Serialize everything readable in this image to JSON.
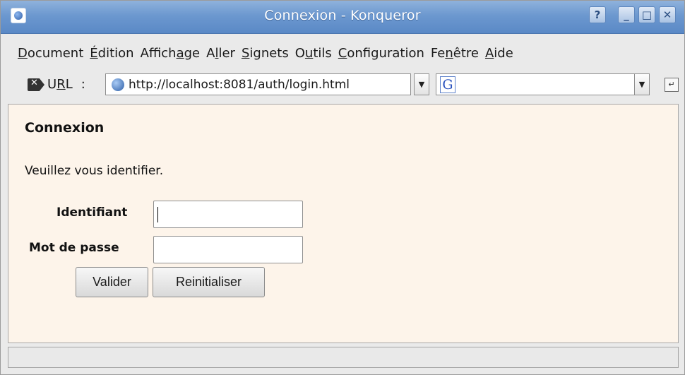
{
  "window": {
    "title": "Connexion - Konqueror",
    "buttons": {
      "help": "?",
      "minimize": "_",
      "maximize": "□",
      "close": "✕"
    }
  },
  "menu": {
    "items": [
      {
        "pre": "",
        "key": "D",
        "post": "ocument"
      },
      {
        "pre": "",
        "key": "É",
        "post": "dition"
      },
      {
        "pre": "Affich",
        "key": "a",
        "post": "ge"
      },
      {
        "pre": "A",
        "key": "l",
        "post": "ler"
      },
      {
        "pre": "",
        "key": "S",
        "post": "ignets"
      },
      {
        "pre": "O",
        "key": "u",
        "post": "tils"
      },
      {
        "pre": "",
        "key": "C",
        "post": "onfiguration"
      },
      {
        "pre": "Fe",
        "key": "n",
        "post": "être"
      },
      {
        "pre": "",
        "key": "A",
        "post": "ide"
      }
    ]
  },
  "toolbar": {
    "url_label_pre": "U",
    "url_label_key": "R",
    "url_label_post": "L",
    "url_label_colon": ":",
    "url_value": "http://localhost:8081/auth/login.html",
    "search_engine_glyph": "G",
    "search_value": ""
  },
  "page": {
    "heading": "Connexion",
    "intro": "Veuillez vous identifier.",
    "fields": {
      "username_label": "Identifiant",
      "username_value": "",
      "password_label": "Mot de passe",
      "password_value": ""
    },
    "buttons": {
      "submit": "Valider",
      "reset": "Reinitialiser"
    }
  },
  "statusbar": {
    "text": ""
  },
  "colors": {
    "titlebar": "#6c98cf",
    "content_background": "#fdf4ea",
    "chrome": "#eaeaea"
  }
}
